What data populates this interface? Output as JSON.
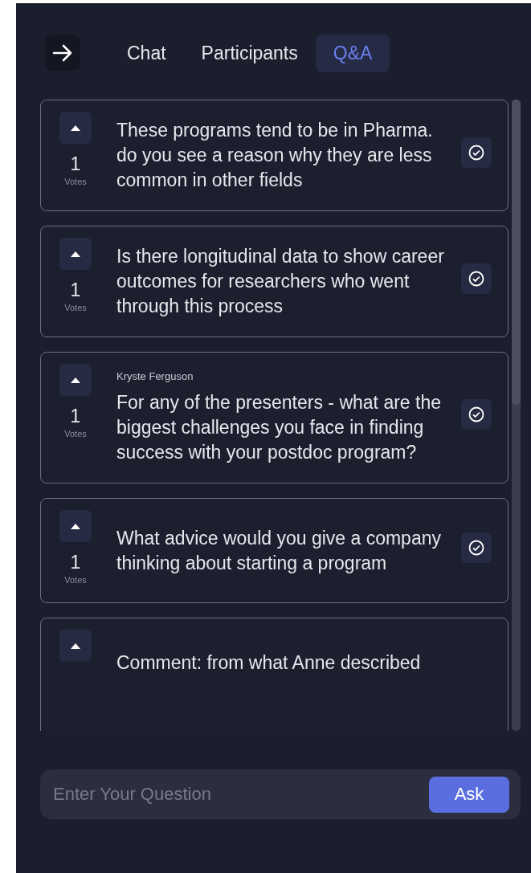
{
  "tabs": [
    {
      "label": "Chat",
      "selected": false
    },
    {
      "label": "Participants",
      "selected": false
    },
    {
      "label": "Q&A",
      "selected": true
    }
  ],
  "questions": [
    {
      "text": "These programs tend to be in Pharma. do you see a reason why they are less common in other fields",
      "votes": "1",
      "votes_label": "Votes",
      "answered": true
    },
    {
      "text": "Is there longitudinal data to show career outcomes for researchers who went through this process",
      "votes": "1",
      "votes_label": "Votes",
      "answered": true
    },
    {
      "author": "Kryste Ferguson",
      "text": "For any of the presenters - what are the biggest challenges you face in finding success with your postdoc program?",
      "votes": "1",
      "votes_label": "Votes",
      "answered": true
    },
    {
      "text": "What advice would you give a company thinking about starting a program",
      "votes": "1",
      "votes_label": "Votes",
      "answered": true
    },
    {
      "text": "Comment: from what Anne described",
      "answered": false
    }
  ],
  "question_input": {
    "placeholder": "Enter Your Question"
  },
  "ask_button": "Ask"
}
